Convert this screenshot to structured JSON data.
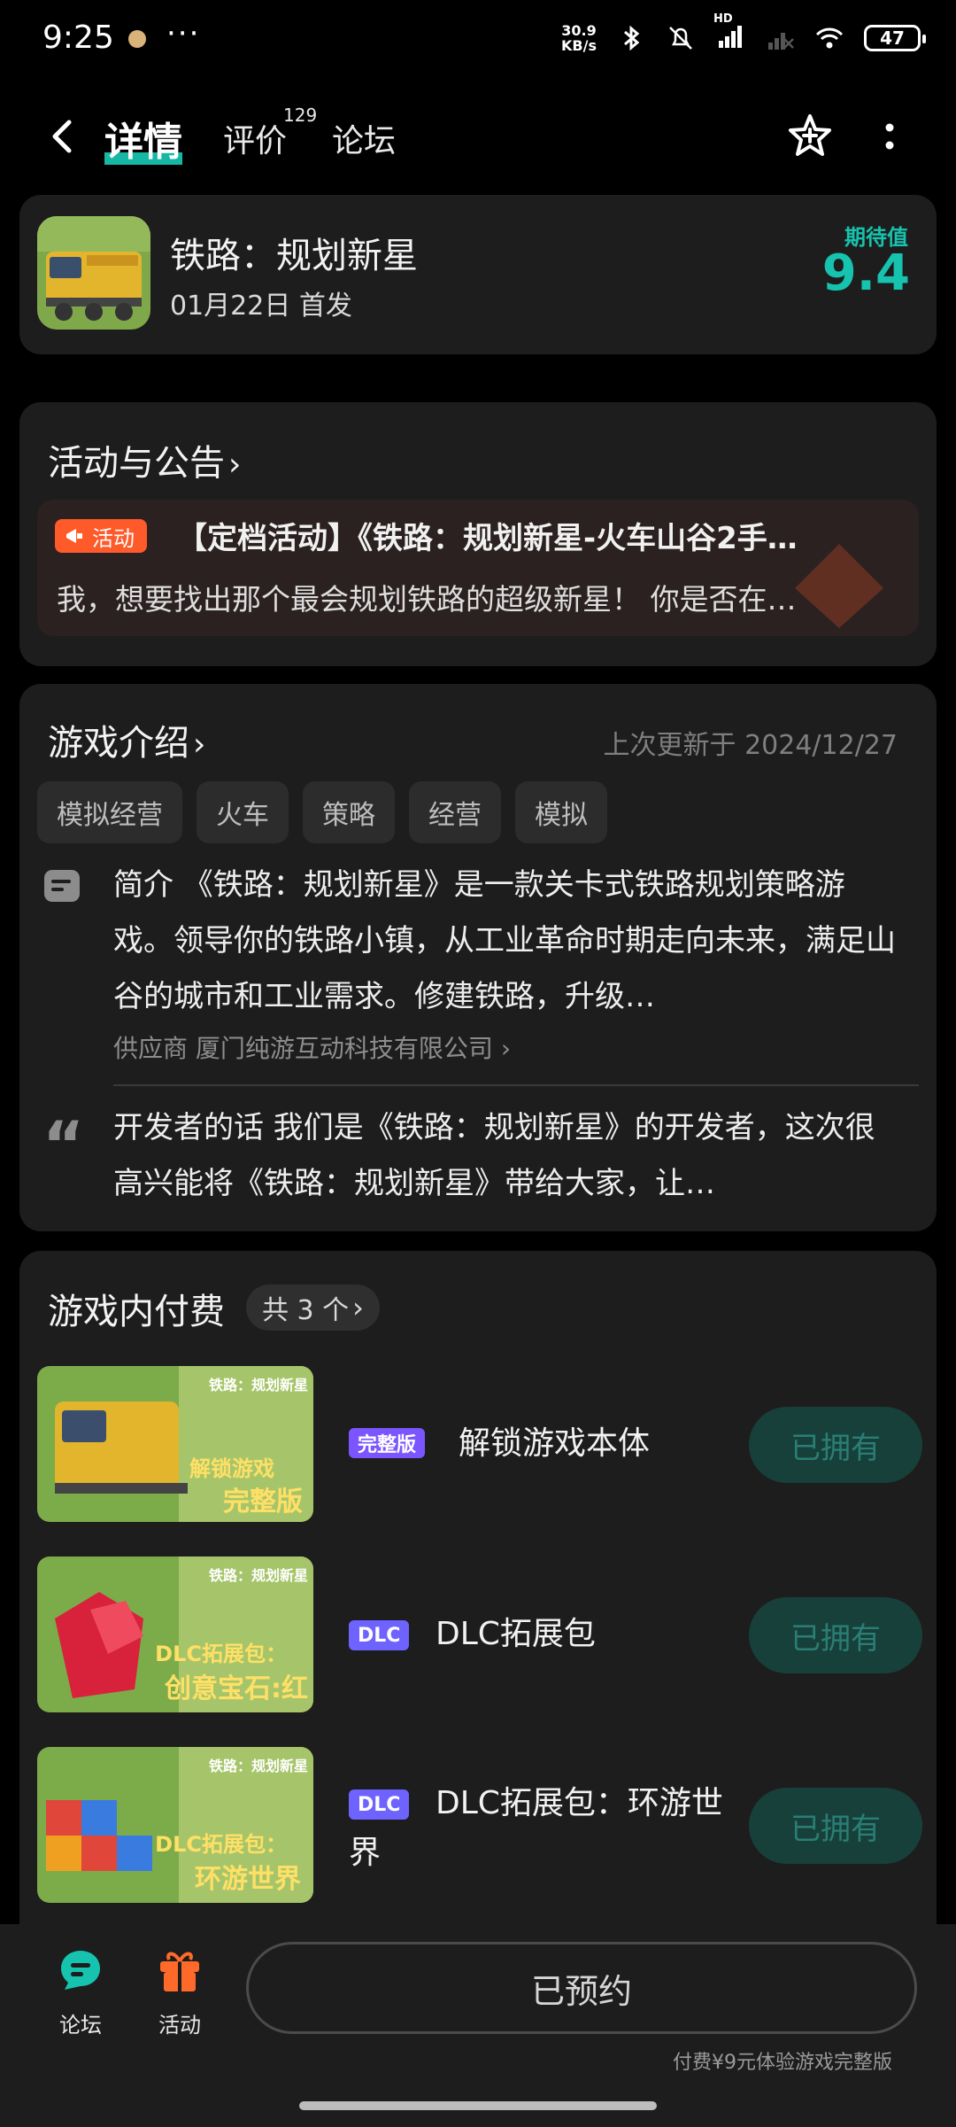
{
  "status_bar": {
    "time": "9:25",
    "dots": "···",
    "net_speed_value": "30.9",
    "net_speed_unit": "KB/s",
    "network_label": "HD",
    "battery": "47"
  },
  "nav": {
    "tabs": [
      {
        "label": "详情",
        "active": true
      },
      {
        "label": "评价",
        "badge": "129"
      },
      {
        "label": "论坛"
      }
    ]
  },
  "game": {
    "title": "铁路：规划新星",
    "release": "01月22日 首发",
    "expect_label": "期待值",
    "expect_value": "9.4"
  },
  "activity": {
    "section_title": "活动与公告",
    "badge": "活动",
    "headline": "【定档活动】《铁路：规划新星-火车山谷2手…",
    "body": "我，想要找出那个最会规划铁路的超级新星！ 你是否在…"
  },
  "intro": {
    "section_title": "游戏介绍",
    "updated": "上次更新于 2024/12/27",
    "tags": [
      "模拟经营",
      "火车",
      "策略",
      "经营",
      "模拟"
    ],
    "description": "简介 《铁路：规划新星》是一款关卡式铁路规划策略游戏。领导你的铁路小镇，从工业革命时期走向未来，满足山谷的城市和工业需求。修建铁路，升级…",
    "supplier": "供应商 厦门纯游互动科技有限公司",
    "dev_words": "开发者的话 我们是《铁路：规划新星》的开发者，这次很高兴能将《铁路：规划新星》带给大家，让…"
  },
  "payments": {
    "section_title": "游戏内付费",
    "count": "共 3 个",
    "items": [
      {
        "badge": "完整版",
        "name": "解锁游戏本体",
        "button": "已拥有",
        "thumb_logo": "铁路：规划新星",
        "thumb_caption1": "解锁游戏",
        "thumb_caption2": "完整版"
      },
      {
        "badge": "DLC",
        "name": "DLC拓展包",
        "button": "已拥有",
        "thumb_logo": "铁路：规划新星",
        "thumb_caption1": "DLC拓展包：",
        "thumb_caption2": "创意宝石:红"
      },
      {
        "badge": "DLC",
        "name": "DLC拓展包：环游世界",
        "button": "已拥有",
        "thumb_logo": "铁路：规划新星",
        "thumb_caption1": "DLC拓展包：",
        "thumb_caption2": "环游世界"
      }
    ]
  },
  "bottom": {
    "forum_label": "论坛",
    "activity_label": "活动",
    "reserve_label": "已预约",
    "note": "付费¥9元体验游戏完整版"
  },
  "colors": {
    "accent": "#16c3ae",
    "background": "#000000",
    "card": "#1d1d1d",
    "activity_orange": "#ff5a2a",
    "badge_purple": "#7b55ff"
  }
}
